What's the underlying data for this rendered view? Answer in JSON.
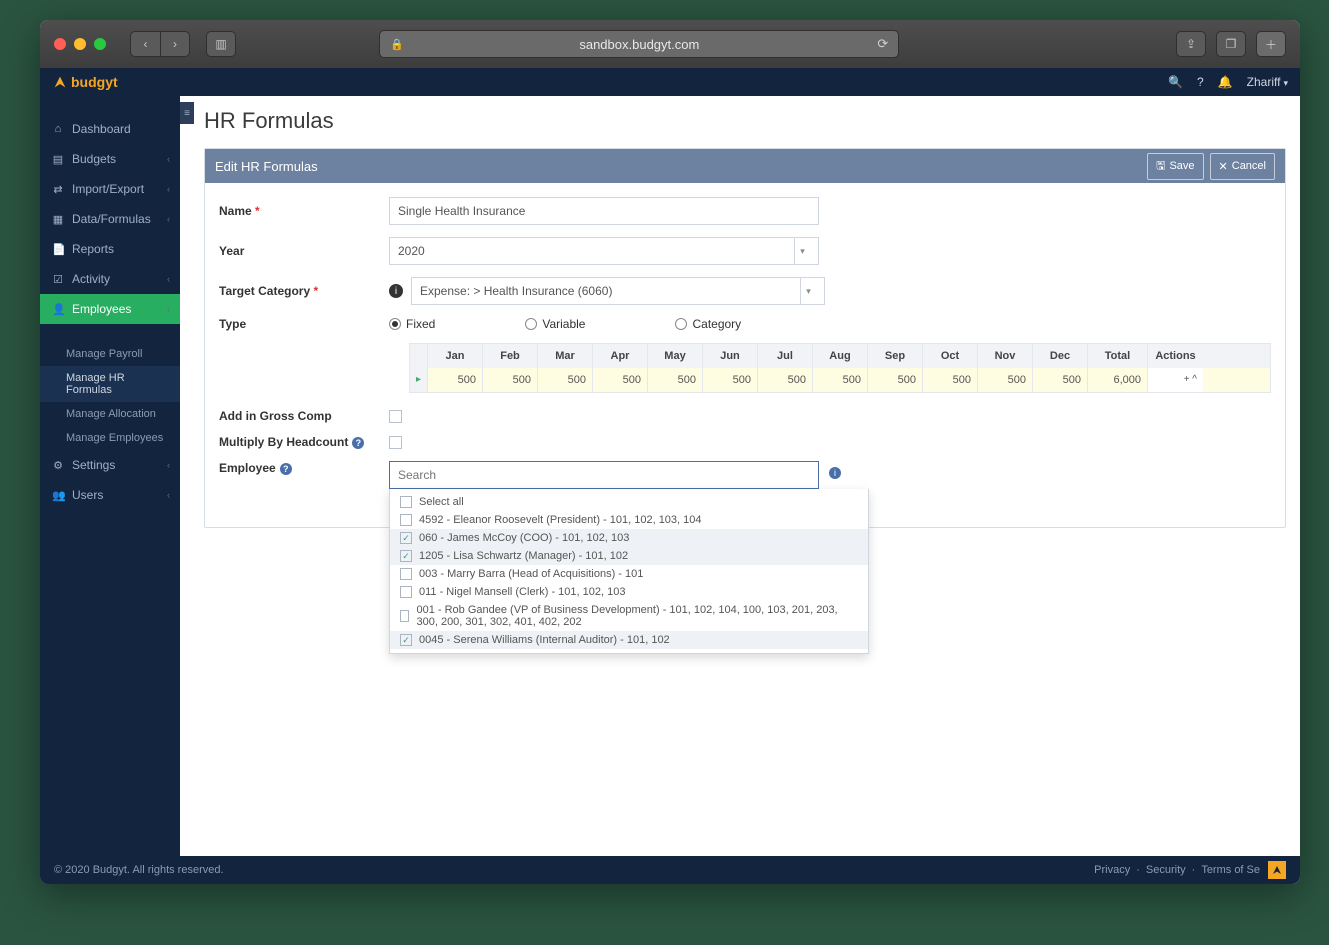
{
  "browser": {
    "url": "sandbox.budgyt.com"
  },
  "app": {
    "brand": "budgyt",
    "user": "Zhariff"
  },
  "sidebar": {
    "items": [
      {
        "label": "Dashboard",
        "icon": "home-icon"
      },
      {
        "label": "Budgets",
        "icon": "bars-icon",
        "expandable": true
      },
      {
        "label": "Import/Export",
        "icon": "transfer-icon",
        "expandable": true
      },
      {
        "label": "Data/Formulas",
        "icon": "db-icon",
        "expandable": true
      },
      {
        "label": "Reports",
        "icon": "doc-icon"
      },
      {
        "label": "Activity",
        "icon": "check-icon",
        "expandable": true
      },
      {
        "label": "Employees",
        "icon": "user-icon",
        "expandable": true,
        "active": true
      },
      {
        "label": "Settings",
        "icon": "gear-icon",
        "expandable": true
      },
      {
        "label": "Users",
        "icon": "users-icon",
        "expandable": true
      }
    ],
    "employees_sub": [
      {
        "label": "Manage Payroll"
      },
      {
        "label": "Manage HR Formulas",
        "on": true
      },
      {
        "label": "Manage Allocation"
      },
      {
        "label": "Manage Employees"
      }
    ]
  },
  "page": {
    "title": "HR Formulas",
    "panel_title": "Edit HR Formulas",
    "save": "Save",
    "cancel": "Cancel"
  },
  "form": {
    "name_label": "Name",
    "name_value": "Single Health Insurance",
    "year_label": "Year",
    "year_value": "2020",
    "target_label": "Target Category",
    "target_value": "Expense: > Health Insurance (6060)",
    "type_label": "Type",
    "type_options": {
      "fixed": "Fixed",
      "variable": "Variable",
      "category": "Category"
    },
    "type_selected": "fixed",
    "gross_label": "Add in Gross Comp",
    "headcount_label": "Multiply By Headcount",
    "employee_label": "Employee",
    "employee_placeholder": "Search"
  },
  "months": {
    "headers": [
      "Jan",
      "Feb",
      "Mar",
      "Apr",
      "May",
      "Jun",
      "Jul",
      "Aug",
      "Sep",
      "Oct",
      "Nov",
      "Dec",
      "Total",
      "Actions"
    ],
    "values": [
      "500",
      "500",
      "500",
      "500",
      "500",
      "500",
      "500",
      "500",
      "500",
      "500",
      "500",
      "500",
      "6,000",
      "+ ^"
    ]
  },
  "employee_dd": {
    "select_all": "Select all",
    "options": [
      {
        "checked": false,
        "label": "4592 - Eleanor Roosevelt (President) - 101, 102, 103, 104"
      },
      {
        "checked": true,
        "label": "060 - James McCoy (COO) - 101, 102, 103"
      },
      {
        "checked": true,
        "label": "1205 - Lisa Schwartz (Manager) - 101, 102"
      },
      {
        "checked": false,
        "label": "003 - Marry Barra (Head of Acquisitions) - 101"
      },
      {
        "checked": false,
        "label": "011 - Nigel Mansell (Clerk) - 101, 102, 103"
      },
      {
        "checked": false,
        "label": "001 - Rob Gandee (VP of Business Development) - 101, 102, 104, 100, 103, 201, 203, 300, 200, 301, 302, 401, 402, 202"
      },
      {
        "checked": true,
        "label": "0045 - Serena Williams (Internal Auditor) - 101, 102"
      }
    ]
  },
  "footer": {
    "copyright": "© 2020 Budgyt. All rights reserved.",
    "links": [
      "Privacy",
      "Security",
      "Terms of Se"
    ]
  }
}
